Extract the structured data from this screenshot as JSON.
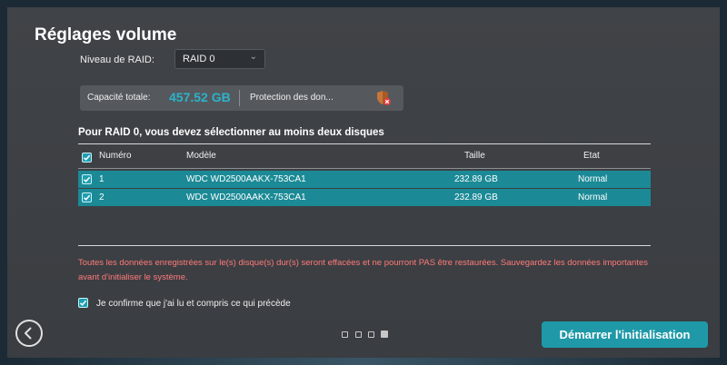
{
  "dialog": {
    "title": "Réglages volume",
    "raid_label": "Niveau de RAID:",
    "raid_value": "RAID 0",
    "capacity_label": "Capacité totale:",
    "capacity_value": "457.52 GB",
    "protection_label": "Protection des don...",
    "section_title": "Pour RAID 0, vous devez sélectionner au moins deux disques",
    "warning": "Toutes les données enregistrées sur le(s) disque(s) dur(s) seront effacées et ne pourront PAS être restaurées. Sauvegardez les données importantes avant d'initialiser le système.",
    "confirm_label": "Je confirme que j'ai lu et compris ce qui précède",
    "start_button": "Démarrer l'initialisation"
  },
  "table": {
    "headers": {
      "number": "Numéro",
      "model": "Modèle",
      "size": "Taille",
      "state": "Etat"
    },
    "rows": [
      {
        "number": "1",
        "model": "WDC WD2500AAKX-753CA1",
        "size": "232.89 GB",
        "state": "Normal",
        "checked": true
      },
      {
        "number": "2",
        "model": "WDC WD2500AAKX-753CA1",
        "size": "232.89 GB",
        "state": "Normal",
        "checked": true
      }
    ]
  },
  "pagination": {
    "pages": 4,
    "current": 4
  },
  "colors": {
    "accent": "#1f99a8",
    "row_selected": "#1b8a96",
    "capacity": "#2bb3c9",
    "warning": "#ff7a7a"
  },
  "icons": {
    "shield": "shield-warning-icon",
    "back": "back-arrow-icon"
  }
}
